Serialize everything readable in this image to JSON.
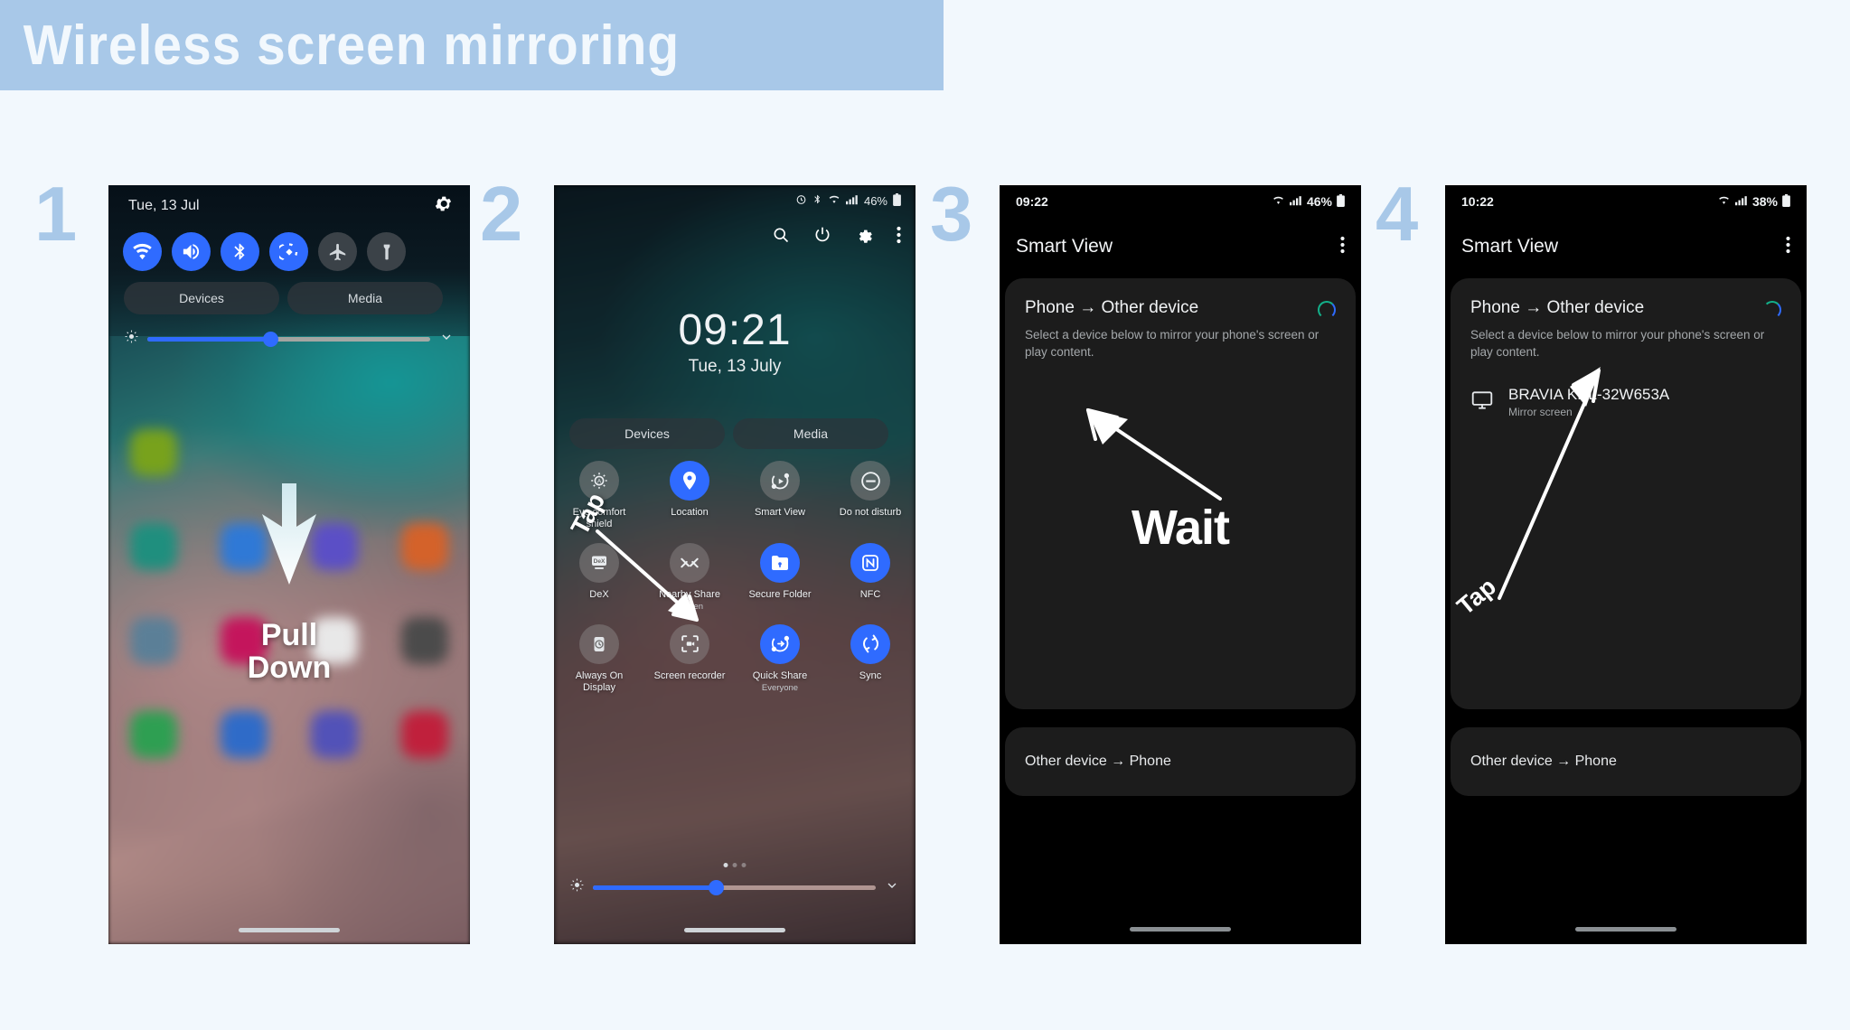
{
  "banner": {
    "title": "Wireless screen mirroring"
  },
  "steps": [
    {
      "number": "1"
    },
    {
      "number": "2"
    },
    {
      "number": "3"
    },
    {
      "number": "4"
    }
  ],
  "phone1": {
    "date": "Tue, 13 Jul",
    "toggles": [
      {
        "name": "wifi",
        "on": true
      },
      {
        "name": "sound",
        "on": true
      },
      {
        "name": "bluetooth",
        "on": true
      },
      {
        "name": "auto-rotate",
        "on": true
      },
      {
        "name": "airplane-mode",
        "on": false
      },
      {
        "name": "flashlight",
        "on": false
      }
    ],
    "pills": [
      "Devices",
      "Media"
    ],
    "brightness_percent": 43,
    "hint": {
      "line1": "Pull",
      "line2": "Down"
    }
  },
  "phone2": {
    "status": {
      "battery": "46%"
    },
    "clock": "09:21",
    "date": "Tue, 13 July",
    "pills": [
      "Devices",
      "Media"
    ],
    "header_icons": [
      "search-icon",
      "power-icon",
      "settings-icon",
      "more-options-icon"
    ],
    "tiles": [
      {
        "label": "Eye comfort shield",
        "sub": "",
        "on": false,
        "icon": "eye-comfort-icon"
      },
      {
        "label": "Location",
        "sub": "",
        "on": true,
        "icon": "location-pin-icon"
      },
      {
        "label": "Smart View",
        "sub": "",
        "on": false,
        "icon": "smart-view-icon"
      },
      {
        "label": "Do not disturb",
        "sub": "",
        "on": false,
        "icon": "do-not-disturb-icon"
      },
      {
        "label": "DeX",
        "sub": "",
        "on": false,
        "icon": "dex-icon"
      },
      {
        "label": "Nearby Share",
        "sub": "Hidden",
        "on": false,
        "icon": "nearby-share-icon"
      },
      {
        "label": "Secure Folder",
        "sub": "",
        "on": true,
        "icon": "secure-folder-icon"
      },
      {
        "label": "NFC",
        "sub": "",
        "on": true,
        "icon": "nfc-icon"
      },
      {
        "label": "Always On Display",
        "sub": "",
        "on": false,
        "icon": "always-on-display-icon"
      },
      {
        "label": "Screen recorder",
        "sub": "",
        "on": false,
        "icon": "screen-recorder-icon"
      },
      {
        "label": "Quick Share",
        "sub": "Everyone",
        "on": true,
        "icon": "quick-share-icon"
      },
      {
        "label": "Sync",
        "sub": "",
        "on": true,
        "icon": "sync-icon"
      }
    ],
    "brightness_percent": 45,
    "hint": {
      "tap": "Tap"
    }
  },
  "phone3": {
    "status": {
      "time": "09:22",
      "battery": "46%"
    },
    "app_title": "Smart View",
    "section_title": "Phone → Other device",
    "section_desc": "Select a device below to mirror your phone's screen or play content.",
    "bottom_section": "Other device → Phone",
    "hint": {
      "wait": "Wait"
    }
  },
  "phone4": {
    "status": {
      "time": "10:22",
      "battery": "38%"
    },
    "app_title": "Smart View",
    "section_title": "Phone → Other device",
    "section_desc": "Select a device below to mirror your phone's screen or play content.",
    "device": {
      "name": "BRAVIA KDL-32W653A",
      "sub": "Mirror screen"
    },
    "bottom_section": "Other device → Phone",
    "hint": {
      "tap": "Tap"
    }
  },
  "colors": {
    "banner_bg": "#a8c8e8",
    "page_bg": "#f2f8fd",
    "accent_blue": "#2f6bff",
    "step_number": "#a8c8e8"
  }
}
